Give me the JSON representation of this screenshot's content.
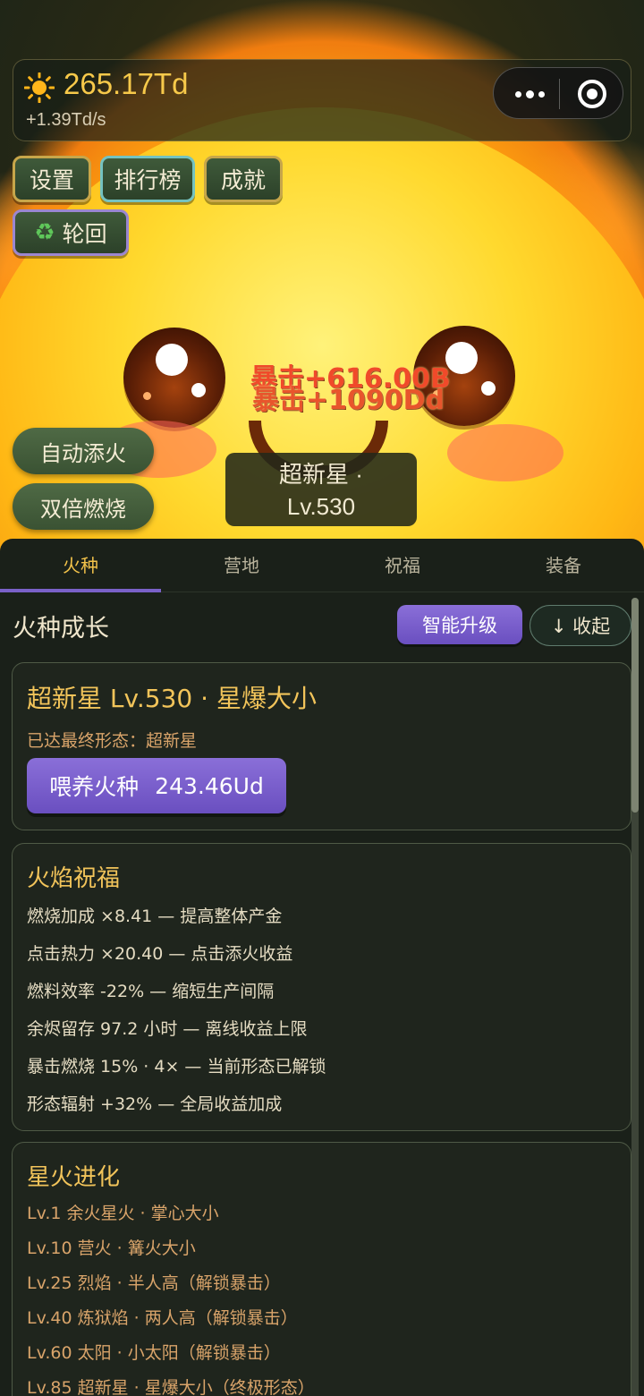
{
  "currency": {
    "amount": "265.17Td",
    "rate": "+1.39Td/s"
  },
  "top_buttons": {
    "settings": "设置",
    "leaderboard": "排行榜",
    "achievements": "成就",
    "rebirth": "轮回"
  },
  "side_buttons": {
    "auto_fuel": "自动添火",
    "double_burn": "双倍燃烧"
  },
  "floating_texts": [
    "暴击+616.00B",
    "暴击+1090Dd"
  ],
  "stage_badge": {
    "line1": "超新星 ·",
    "line2": "Lv.530"
  },
  "tabs": [
    "火种",
    "营地",
    "祝福",
    "装备"
  ],
  "section": {
    "title": "火种成长",
    "smart_upgrade": "智能升级",
    "collapse": "↓ 收起"
  },
  "growth_card": {
    "title": "超新星 Lv.530 · 星爆大小",
    "subtitle": "已达最终形态：超新星",
    "feed_label": "喂养火种",
    "feed_cost": "243.46Ud"
  },
  "blessing_card": {
    "title": "火焰祝福",
    "lines": [
      "燃烧加成 ×8.41 — 提高整体产金",
      "点击热力 ×20.40 — 点击添火收益",
      "燃料效率 -22% — 缩短生产间隔",
      "余烬留存 97.2 小时 — 离线收益上限",
      "暴击燃烧 15% · 4× — 当前形态已解锁",
      "形态辐射 +32% — 全局收益加成"
    ]
  },
  "evolution_card": {
    "title": "星火进化",
    "lines": [
      "Lv.1  余火星火 · 掌心大小",
      "Lv.10  营火 · 篝火大小",
      "Lv.25  烈焰 · 半人高（解锁暴击）",
      "Lv.40  炼狱焰 · 两人高（解锁暴击）",
      "Lv.60  太阳 · 小太阳（解锁暴击）",
      "Lv.85  超新星 · 星爆大小（终极形态）"
    ]
  },
  "colors": {
    "accent_purple": "#7a61c8",
    "gold": "#f2c45a",
    "active_tab": "#f2c24a"
  }
}
